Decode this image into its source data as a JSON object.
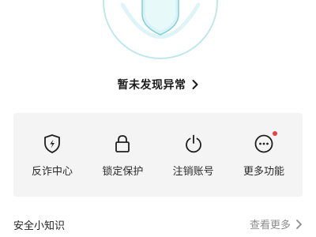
{
  "status": {
    "message": "暂未发现异常",
    "chevron_icon": "chevron-right-icon"
  },
  "hero": {
    "icon": "security-shield-icon",
    "ring_color": "#bfe8ec",
    "shield_color": "#d8f3f6"
  },
  "tools": [
    {
      "label": "反诈中心",
      "icon": "anti-fraud-shield-icon"
    },
    {
      "label": "锁定保护",
      "icon": "lock-icon"
    },
    {
      "label": "注销账号",
      "icon": "power-icon"
    },
    {
      "label": "更多功能",
      "icon": "more-dots-icon",
      "badge_color": "#e8414a"
    }
  ],
  "tips": {
    "title": "安全小知识",
    "more_label": "查看更多",
    "chevron_icon": "chevron-right-icon"
  }
}
